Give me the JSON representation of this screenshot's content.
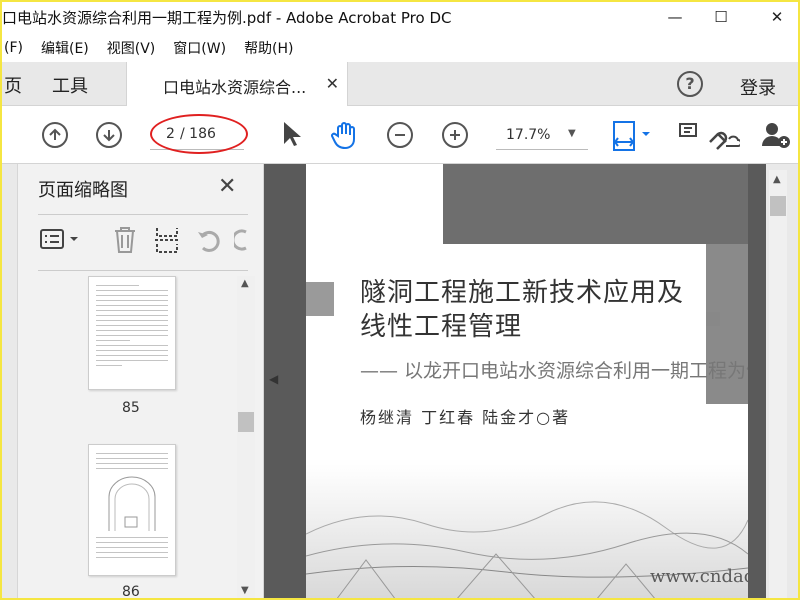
{
  "window": {
    "title": "口电站水资源综合利用一期工程为例.pdf - Adobe Acrobat Pro DC",
    "minimize": "—",
    "maximize": "☐",
    "close": "✕"
  },
  "menu": {
    "items": [
      "(F)",
      "编辑(E)",
      "视图(V)",
      "窗口(W)",
      "帮助(H)"
    ]
  },
  "tabs": {
    "home": "页",
    "tools": "工具",
    "doc": "口电站水资源综合...",
    "doc_close": "✕",
    "help": "?",
    "login": "登录"
  },
  "toolbar": {
    "prev_icon": "arrow-up-circle-icon",
    "next_icon": "arrow-down-circle-icon",
    "page_current": "2",
    "page_total": "/ 186",
    "zoom": "17.7%",
    "icons": [
      "select-arrow-icon",
      "hand-icon",
      "zoom-out-icon",
      "zoom-in-icon",
      "fit-page-icon",
      "comment-icon",
      "sign-icon",
      "add-user-icon"
    ]
  },
  "panel": {
    "title": "页面缩略图",
    "close": "✕",
    "tools": [
      "options-icon",
      "delete-icon",
      "extract-icon",
      "undo-icon",
      "redo-icon"
    ],
    "thumbnails": [
      {
        "page": "85"
      },
      {
        "page": "86"
      }
    ]
  },
  "document": {
    "title_line1": "隧洞工程施工新技术应用及",
    "title_line2": "线性工程管理",
    "subtitle": "—— 以龙开口电站水资源综合利用一期工程为例",
    "authors": "杨继清  丁红春  陆金才○著",
    "watermark": "www.cndao.com"
  },
  "colors": {
    "accent_blue": "#1473e6",
    "highlight_oval": "#e02020",
    "frame": "#f5e642"
  }
}
